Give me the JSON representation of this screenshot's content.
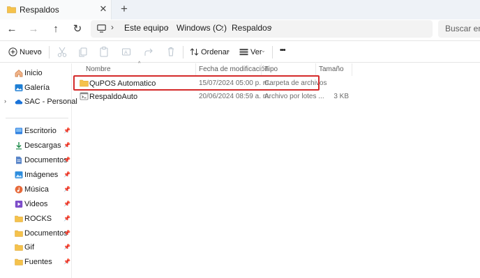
{
  "tab": {
    "title": "Respaldos",
    "close_label": "✕",
    "new_tab_label": "+"
  },
  "nav_buttons": {
    "back": "←",
    "forward": "→",
    "up": "↑",
    "refresh": "↻"
  },
  "breadcrumb": [
    "Este equipo",
    "Windows (C:)",
    "Respaldos"
  ],
  "search": {
    "placeholder": "Buscar en Respaldos"
  },
  "commands": {
    "new_label": "Nuevo",
    "sort_label": "Ordenar",
    "view_label": "Ver",
    "more_label": "•••"
  },
  "sidebar": {
    "top_items": [
      {
        "label": "Inicio",
        "icon": "home-icon"
      },
      {
        "label": "Galería",
        "icon": "gallery-icon"
      },
      {
        "label": "SAC - Personal",
        "icon": "cloud-icon"
      }
    ],
    "quick_access": [
      {
        "label": "Escritorio",
        "icon": "desktop-icon"
      },
      {
        "label": "Descargas",
        "icon": "download-icon"
      },
      {
        "label": "Documentos",
        "icon": "documents-icon"
      },
      {
        "label": "Imágenes",
        "icon": "pictures-icon"
      },
      {
        "label": "Música",
        "icon": "music-icon"
      },
      {
        "label": "Videos",
        "icon": "videos-icon"
      },
      {
        "label": "ROCKS",
        "icon": "folder-icon"
      },
      {
        "label": "Documentos",
        "icon": "folder-icon"
      },
      {
        "label": "Gif",
        "icon": "folder-icon"
      },
      {
        "label": "Fuentes",
        "icon": "folder-icon"
      }
    ]
  },
  "columns": {
    "name": "Nombre",
    "modified": "Fecha de modificación",
    "type": "Tipo",
    "size": "Tamaño"
  },
  "files": [
    {
      "name": "QuPOS Automatico",
      "modified": "15/07/2024 05:00 p. m.",
      "type": "Carpeta de archivos",
      "size": "",
      "icon": "folder-icon"
    },
    {
      "name": "RespaldoAuto",
      "modified": "20/06/2024 08:59 a. m.",
      "type": "Archivo por lotes ...",
      "size": "3 KB",
      "icon": "batch-file-icon"
    }
  ],
  "colors": {
    "folder": "#f5c24c",
    "highlight": "#d42a2a",
    "accent": "#0067c0"
  }
}
